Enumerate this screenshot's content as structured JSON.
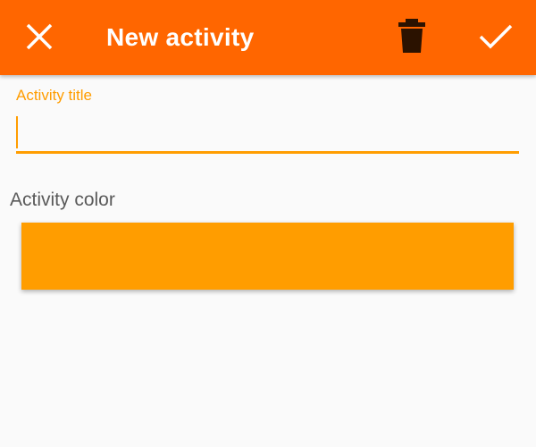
{
  "toolbar": {
    "title": "New activity",
    "close_icon": "close-icon",
    "delete_icon": "trash-icon",
    "save_icon": "check-icon",
    "background_color": "#ff6600"
  },
  "form": {
    "title_field": {
      "label": "Activity title",
      "value": "",
      "accent_color": "#ff9d00"
    },
    "color_field": {
      "label": "Activity color",
      "selected_color": "#ff9d00"
    }
  }
}
